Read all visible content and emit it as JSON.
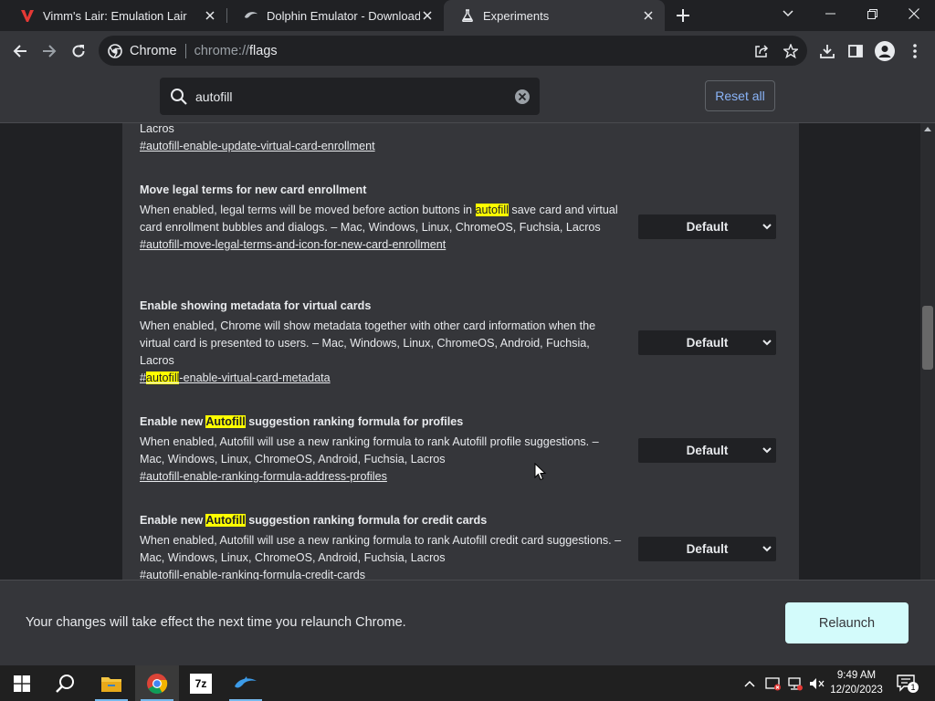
{
  "tabs": [
    {
      "title": "Vimm's Lair: Emulation Lair",
      "icon": "vimms-lair-logo-icon",
      "active": false
    },
    {
      "title": "Dolphin Emulator - Download",
      "icon": "dolphin-logo-icon",
      "active": false
    },
    {
      "title": "Experiments",
      "icon": "flask-icon",
      "active": true
    }
  ],
  "omnibox": {
    "site_name": "Chrome",
    "url_scheme": "chrome://",
    "url_host": "flags"
  },
  "flags_header": {
    "search_value": "autofill",
    "reset_label": "Reset all"
  },
  "flags": {
    "partial": {
      "desc_tail": "Lacros",
      "link": "#autofill-enable-update-virtual-card-enrollment"
    },
    "items": [
      {
        "title": "Move legal terms for new card enrollment",
        "desc_a": "When enabled, legal terms will be moved before action buttons in ",
        "desc_hl": "autofill",
        "desc_b": " save card and virtual card enrollment bubbles and dialogs. – Mac, Windows, Linux, ChromeOS, Fuchsia, Lacros",
        "link": "#autofill-move-legal-terms-and-icon-for-new-card-enrollment",
        "select": "Default"
      },
      {
        "title": "Enable showing metadata for virtual cards",
        "desc": "When enabled, Chrome will show metadata together with other card information when the virtual card is presented to users. – Mac, Windows, Linux, ChromeOS, Android, Fuchsia, Lacros",
        "link_pre": "#",
        "link_hl": "autofill",
        "link_post": "-enable-virtual-card-metadata",
        "select": "Default"
      },
      {
        "title_a": "Enable new ",
        "title_hl": "Autofill",
        "title_b": " suggestion ranking formula for profiles",
        "desc": "When enabled, Autofill will use a new ranking formula to rank Autofill profile suggestions. – Mac, Windows, Linux, ChromeOS, Android, Fuchsia, Lacros",
        "link": "#autofill-enable-ranking-formula-address-profiles",
        "select": "Default"
      },
      {
        "title_a": "Enable new ",
        "title_hl": "Autofill",
        "title_b": " suggestion ranking formula for credit cards",
        "desc": "When enabled, Autofill will use a new ranking formula to rank Autofill credit card suggestions. – Mac, Windows, Linux, ChromeOS, Android, Fuchsia, Lacros",
        "link": "#autofill-enable-ranking-formula-credit-cards",
        "select": "Default"
      }
    ]
  },
  "relaunch": {
    "message": "Your changes will take effect the next time you relaunch Chrome.",
    "button_label": "Relaunch"
  },
  "taskbar": {
    "time": "9:49 AM",
    "date": "12/20/2023",
    "notification_count": "1",
    "app_7zip_label": "7z"
  }
}
